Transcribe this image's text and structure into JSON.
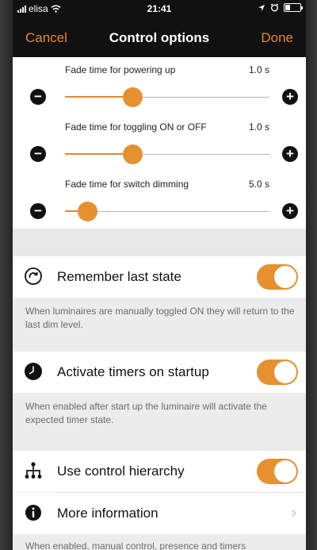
{
  "status_bar": {
    "carrier": "elisa",
    "time": "21:41"
  },
  "nav": {
    "cancel_label": "Cancel",
    "title": "Control options",
    "done_label": "Done"
  },
  "sliders": [
    {
      "label": "Fade time for powering up",
      "value": "1.0 s",
      "level": 0.33
    },
    {
      "label": "Fade time for toggling ON or OFF",
      "value": "1.0 s",
      "level": 0.33
    },
    {
      "label": "Fade time for switch dimming",
      "value": "5.0 s",
      "level": 0.11
    }
  ],
  "settings": {
    "remember": {
      "label": "Remember last state",
      "icon": "restore-arrow-icon",
      "toggle_on": true,
      "footer": "When luminaires are manually toggled ON they will return to the last dim level."
    },
    "timers": {
      "label": "Activate timers on startup",
      "icon": "clock-icon",
      "toggle_on": true,
      "footer": "When enabled after start up the luminaire will activate the expected timer state."
    },
    "hierarchy": {
      "label": "Use control hierarchy",
      "icon": "hierarchy-icon",
      "toggle_on": true
    },
    "more_info": {
      "label": "More information",
      "icon": "info-icon"
    },
    "hierarchy_footer": "When enabled, manual control, presence and timers"
  },
  "colors": {
    "accent": "#e7902f",
    "nav_background": "#111111",
    "section_background": "#e8e8e8"
  }
}
